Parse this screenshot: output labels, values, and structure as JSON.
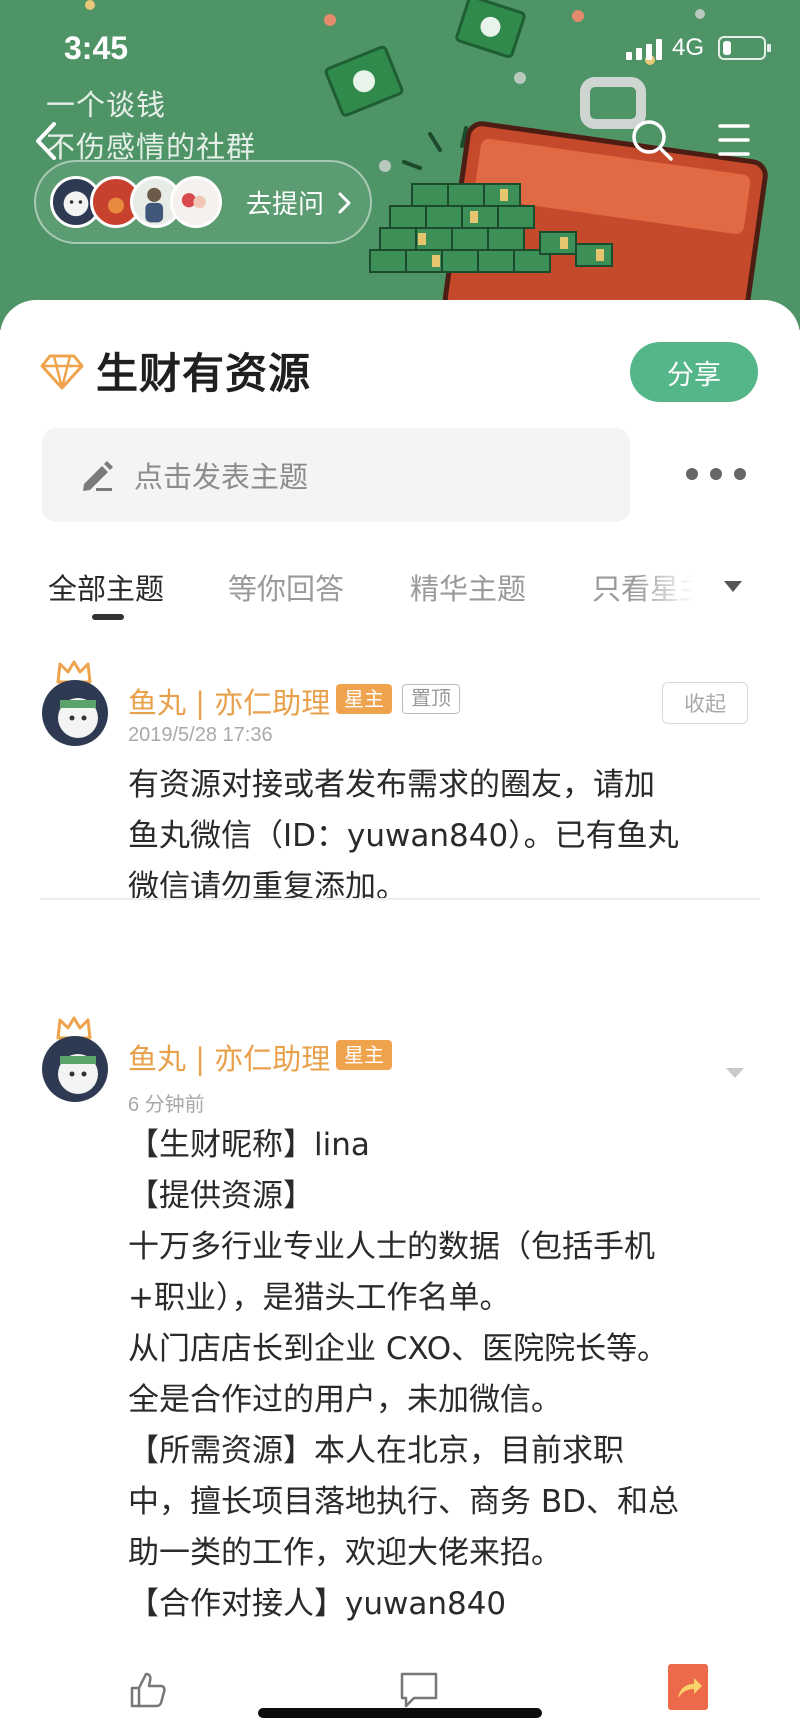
{
  "status_bar": {
    "time": "3:45",
    "network": "4G",
    "battery_level": 0.2
  },
  "header": {
    "slogan_line1": "一个谈钱",
    "slogan_line2": "不伤感情的社群",
    "ask_button_label": "去提问",
    "background_color": "#4f9467"
  },
  "circle": {
    "title": "生财有资源",
    "share_label": "分享",
    "post_placeholder": "点击发表主题"
  },
  "tabs": [
    {
      "label": "全部主题",
      "active": true
    },
    {
      "label": "等你回答",
      "active": false
    },
    {
      "label": "精华主题",
      "active": false
    },
    {
      "label": "只看星主",
      "active": false
    }
  ],
  "posts": [
    {
      "author": "鱼丸 | 亦仁助理",
      "owner_badge": "星主",
      "pinned_badge": "置顶",
      "collapse_label": "收起",
      "time": "2019/5/28 17:36",
      "body": [
        "有资源对接或者发布需求的圈友，请加",
        "鱼丸微信（ID：yuwan840）。已有鱼丸",
        "微信请勿重复添加。"
      ]
    },
    {
      "author": "鱼丸 | 亦仁助理",
      "owner_badge": "星主",
      "time": "6 分钟前",
      "body": [
        "【生财昵称】lina",
        "【提供资源】",
        "十万多行业专业人士的数据（包括手机",
        "+职业），是猎头工作名单。",
        "从门店店长到企业 CXO、医院院长等。",
        "全是合作过的用户，未加微信。",
        "【所需资源】本人在北京，目前求职",
        "中，擅长项目落地执行、商务 BD、和总",
        "助一类的工作，欢迎大佬来招。",
        "【合作对接人】yuwan840"
      ]
    }
  ],
  "colors": {
    "accent_green": "#55b68a",
    "author_orange": "#e8a04b",
    "owner_badge": "#f0a34d"
  },
  "icons": {
    "back": "back-arrow-icon",
    "search": "search-icon",
    "menu": "menu-icon",
    "diamond": "diamond-icon",
    "pencil": "pencil-icon",
    "more": "more-dots-icon",
    "like": "thumbs-up-icon",
    "comment": "comment-icon",
    "share": "share-arrow-icon"
  }
}
